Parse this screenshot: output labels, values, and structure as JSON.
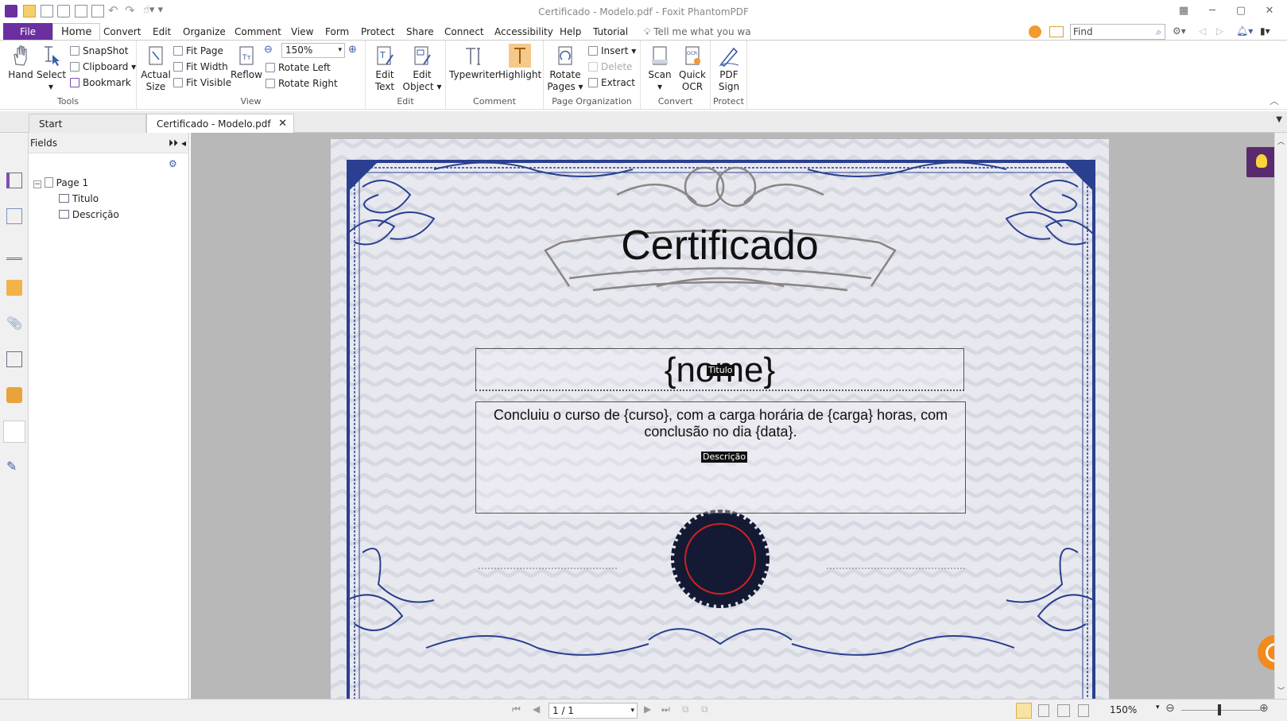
{
  "window": {
    "title": "Certificado - Modelo.pdf - Foxit PhantomPDF"
  },
  "menu": {
    "items": [
      "File",
      "Home",
      "Convert",
      "Edit",
      "Organize",
      "Comment",
      "View",
      "Form",
      "Protect",
      "Share",
      "Connect",
      "Accessibility",
      "Help",
      "Tutorial"
    ],
    "tell_me": "Tell me what you wa",
    "find_placeholder": "Find"
  },
  "ribbon": {
    "tools": {
      "hand": "Hand",
      "select": "Select",
      "snapshot": "SnapShot",
      "clipboard": "Clipboard",
      "bookmark": "Bookmark",
      "label": "Tools"
    },
    "view": {
      "actual_size_1": "Actual",
      "actual_size_2": "Size",
      "fit_page": "Fit Page",
      "fit_width": "Fit Width",
      "fit_visible": "Fit Visible",
      "reflow": "Reflow",
      "zoom": "150%",
      "rotate_left": "Rotate Left",
      "rotate_right": "Rotate Right",
      "label": "View"
    },
    "edit": {
      "edit_text_1": "Edit",
      "edit_text_2": "Text",
      "edit_object_1": "Edit",
      "edit_object_2": "Object",
      "label": "Edit"
    },
    "comment": {
      "typewriter": "Typewriter",
      "highlight": "Highlight",
      "label": "Comment"
    },
    "page_org": {
      "rotate_pages_1": "Rotate",
      "rotate_pages_2": "Pages",
      "insert": "Insert",
      "delete": "Delete",
      "extract": "Extract",
      "label": "Page Organization"
    },
    "convert": {
      "scan": "Scan",
      "quick_ocr_1": "Quick",
      "quick_ocr_2": "OCR",
      "label": "Convert"
    },
    "protect": {
      "pdf_sign_1": "PDF",
      "pdf_sign_2": "Sign",
      "label": "Protect"
    }
  },
  "tabs": {
    "start": "Start",
    "document": "Certificado - Modelo.pdf"
  },
  "fields_panel": {
    "title": "Fields",
    "page": "Page 1",
    "items": [
      "Titulo",
      "Descrição"
    ]
  },
  "certificate": {
    "heading": "Certificado",
    "name_field": "{nome}",
    "name_tag": "Titulo",
    "description": "Concluiu o curso de {curso}, com a carga horária de {carga} horas, com conclusão no dia {data}.",
    "description_tag": "Descrição"
  },
  "status": {
    "page": "1 / 1",
    "zoom": "150%"
  },
  "colors": {
    "accent": "#6b2fa0",
    "border_blue": "#2a3f8f",
    "seal": "#141a33"
  }
}
